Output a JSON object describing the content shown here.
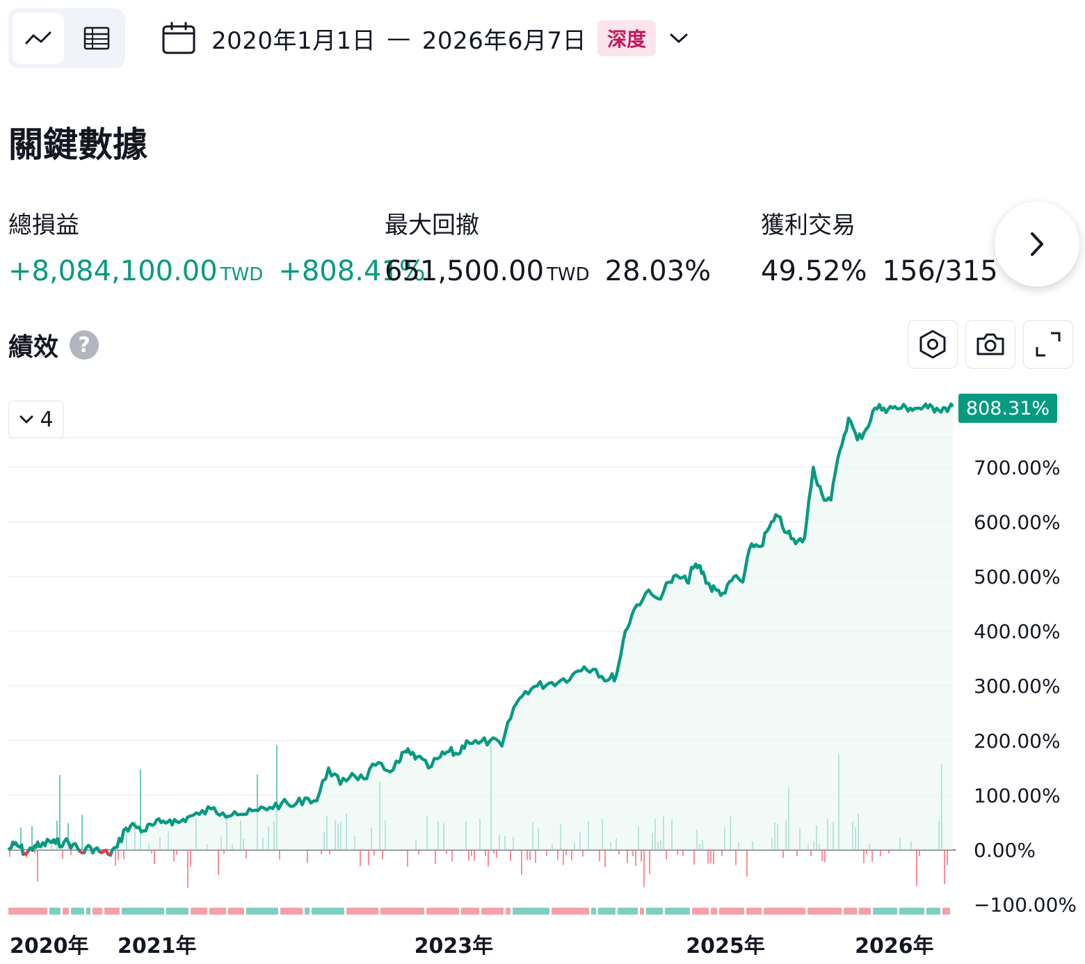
{
  "toolbar": {
    "date_start": "2020年1月1日",
    "date_separator": "—",
    "date_end": "2026年6月7日",
    "badge": "深度",
    "icons": [
      "line-chart-icon",
      "table-icon",
      "calendar-icon",
      "chevron-down-icon"
    ]
  },
  "section_title": "關鍵數據",
  "metrics": {
    "net_profit": {
      "label": "總損益",
      "value": "+8,084,100.00",
      "currency": "TWD",
      "percent": "+808.41%"
    },
    "max_drawdown": {
      "label": "最大回撤",
      "value": "651,500.00",
      "currency": "TWD",
      "percent": "28.03%"
    },
    "profitable_trades": {
      "label": "獲利交易",
      "percent": "49.52%",
      "ratio": "156/315"
    }
  },
  "performance": {
    "title": "績效",
    "help": "?",
    "series_count": "4",
    "current_value_label": "808.31%"
  },
  "colors": {
    "accent_green": "#089981",
    "loss_red": "#f23645",
    "badge_pink": "#c2185b",
    "area_fill": "#e8f6f3"
  },
  "chart_data": {
    "type": "line",
    "title": "",
    "xlabel": "",
    "ylabel": "",
    "ylim": [
      -100,
      820
    ],
    "y_ticks": [
      "700.00%",
      "600.00%",
      "500.00%",
      "400.00%",
      "300.00%",
      "200.00%",
      "100.00%",
      "0.00%",
      "−100.00%"
    ],
    "y_tick_values": [
      700,
      600,
      500,
      400,
      300,
      200,
      100,
      0,
      -100
    ],
    "x_ticks": [
      "2020年",
      "2021年",
      "2023年",
      "2025年",
      "2026年"
    ],
    "x_tick_values": [
      2020.0,
      2020.98,
      2023.0,
      2024.85,
      2026.0
    ],
    "xlim": [
      2020.0,
      2026.43
    ],
    "series": [
      {
        "x": [
          2020.0,
          2020.04,
          2020.08,
          2020.12,
          2020.18,
          2020.22,
          2020.28,
          2020.32,
          2020.38,
          2020.44,
          2020.5,
          2020.56,
          2020.62,
          2020.68,
          2020.74,
          2020.8,
          2020.86,
          2020.92,
          2020.98,
          2021.04,
          2021.1,
          2021.16,
          2021.22,
          2021.3,
          2021.38,
          2021.46,
          2021.54,
          2021.62,
          2021.7,
          2021.78,
          2021.86,
          2021.94,
          2022.02,
          2022.1,
          2022.18,
          2022.26,
          2022.34,
          2022.42,
          2022.5,
          2022.58,
          2022.66,
          2022.7,
          2022.74,
          2022.78,
          2022.86,
          2022.94,
          2023.0,
          2023.06,
          2023.12,
          2023.2,
          2023.28,
          2023.36,
          2023.44,
          2023.52,
          2023.6,
          2023.68,
          2023.76,
          2023.84,
          2023.92,
          2024.0,
          2024.08,
          2024.14,
          2024.2,
          2024.26,
          2024.34,
          2024.42,
          2024.5,
          2024.56,
          2024.62,
          2024.66,
          2024.7,
          2024.74,
          2024.78,
          2024.82,
          2024.88,
          2024.94,
          2025.0,
          2025.06,
          2025.12,
          2025.18,
          2025.24,
          2025.3,
          2025.36,
          2025.42,
          2025.48,
          2025.54,
          2025.6,
          2025.66,
          2025.72,
          2025.78,
          2025.84,
          2025.9,
          2025.96,
          2026.02,
          2026.08,
          2026.14,
          2026.2,
          2026.26,
          2026.32,
          2026.38,
          2026.43
        ],
        "y": [
          0,
          10,
          5,
          -8,
          8,
          6,
          16,
          12,
          15,
          10,
          -5,
          5,
          -3,
          -8,
          5,
          40,
          45,
          35,
          45,
          50,
          55,
          50,
          60,
          65,
          75,
          68,
          70,
          65,
          72,
          78,
          85,
          80,
          95,
          90,
          150,
          120,
          140,
          130,
          155,
          145,
          160,
          180,
          175,
          170,
          150,
          170,
          180,
          175,
          200,
          195,
          200,
          190,
          260,
          290,
          300,
          305,
          310,
          320,
          335,
          330,
          310,
          320,
          400,
          440,
          470,
          460,
          490,
          500,
          490,
          515,
          520,
          500,
          480,
          475,
          470,
          500,
          490,
          560,
          555,
          590,
          610,
          580,
          560,
          570,
          700,
          650,
          640,
          730,
          790,
          750,
          770,
          808.31,
          808.31,
          808.31,
          808.31,
          808.31,
          808.31,
          808.31,
          808.31,
          808.31,
          808.31
        ]
      }
    ],
    "x_axis_label_note": ""
  }
}
